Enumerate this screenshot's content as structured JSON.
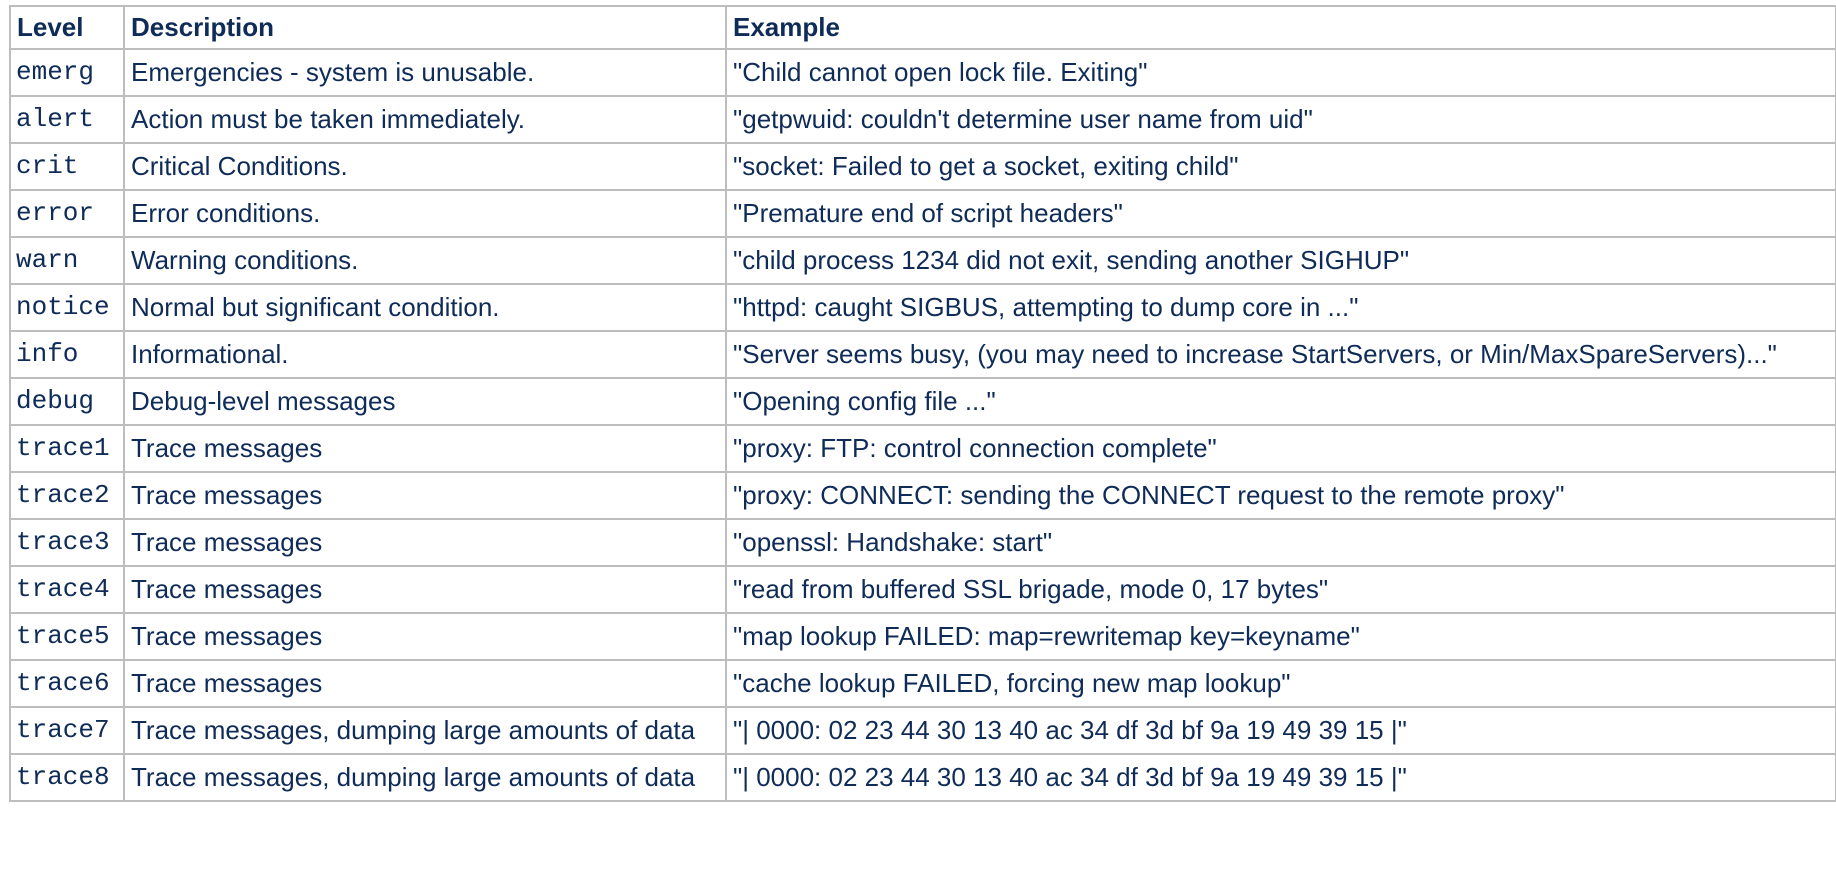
{
  "table": {
    "headers": {
      "level": "Level",
      "description": "Description",
      "example": "Example"
    },
    "rows": [
      {
        "level": "emerg",
        "description": "Emergencies - system is unusable.",
        "example": "\"Child cannot open lock file. Exiting\""
      },
      {
        "level": "alert",
        "description": "Action must be taken immediately.",
        "example": "\"getpwuid: couldn't determine user name from uid\""
      },
      {
        "level": "crit",
        "description": "Critical Conditions.",
        "example": "\"socket: Failed to get a socket, exiting child\""
      },
      {
        "level": "error",
        "description": "Error conditions.",
        "example": "\"Premature end of script headers\""
      },
      {
        "level": "warn",
        "description": "Warning conditions.",
        "example": "\"child process 1234 did not exit, sending another SIGHUP\""
      },
      {
        "level": "notice",
        "description": "Normal but significant condition.",
        "example": "\"httpd: caught SIGBUS, attempting to dump core in ...\""
      },
      {
        "level": "info",
        "description": "Informational.",
        "example": "\"Server seems busy, (you may need to increase StartServers, or Min/MaxSpareServers)...\""
      },
      {
        "level": "debug",
        "description": "Debug-level messages",
        "example": "\"Opening config file ...\""
      },
      {
        "level": "trace1",
        "description": "Trace messages",
        "example": "\"proxy: FTP: control connection complete\""
      },
      {
        "level": "trace2",
        "description": "Trace messages",
        "example": "\"proxy: CONNECT: sending the CONNECT request to the remote proxy\""
      },
      {
        "level": "trace3",
        "description": "Trace messages",
        "example": "\"openssl: Handshake: start\""
      },
      {
        "level": "trace4",
        "description": "Trace messages",
        "example": "\"read from buffered SSL brigade, mode 0, 17 bytes\""
      },
      {
        "level": "trace5",
        "description": "Trace messages",
        "example": "\"map lookup FAILED: map=rewritemap key=keyname\""
      },
      {
        "level": "trace6",
        "description": "Trace messages",
        "example": "\"cache lookup FAILED, forcing new map lookup\""
      },
      {
        "level": "trace7",
        "description": "Trace messages, dumping large amounts of data",
        "example": "\"| 0000: 02 23 44 30 13 40 ac 34 df 3d bf 9a 19 49 39 15 |\""
      },
      {
        "level": "trace8",
        "description": "Trace messages, dumping large amounts of data",
        "example": "\"| 0000: 02 23 44 30 13 40 ac 34 df 3d bf 9a 19 49 39 15 |\""
      }
    ]
  }
}
